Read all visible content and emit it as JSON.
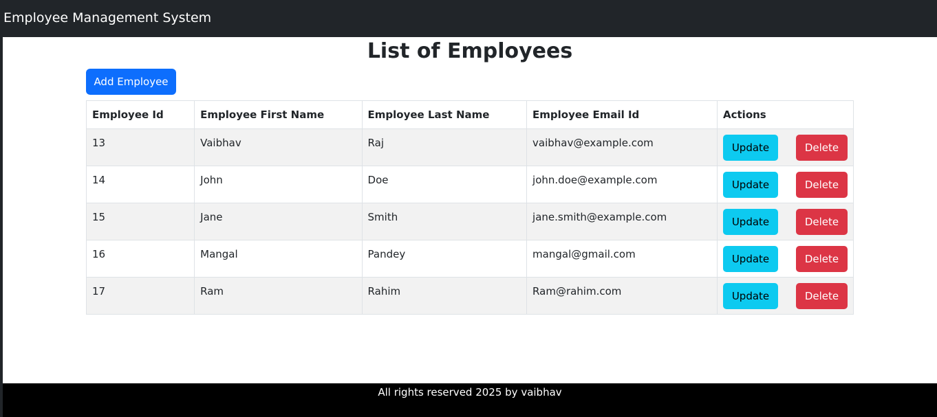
{
  "navbar": {
    "brand": "Employee Management System"
  },
  "main": {
    "title": "List of Employees",
    "add_button_label": "Add Employee"
  },
  "table": {
    "headers": [
      "Employee Id",
      "Employee First Name",
      "Employee Last Name",
      "Employee Email Id",
      "Actions"
    ],
    "rows": [
      {
        "id": "13",
        "first_name": "Vaibhav",
        "last_name": "Raj",
        "email": "vaibhav@example.com"
      },
      {
        "id": "14",
        "first_name": "John",
        "last_name": "Doe",
        "email": "john.doe@example.com"
      },
      {
        "id": "15",
        "first_name": "Jane",
        "last_name": "Smith",
        "email": "jane.smith@example.com"
      },
      {
        "id": "16",
        "first_name": "Mangal",
        "last_name": "Pandey",
        "email": "mangal@gmail.com"
      },
      {
        "id": "17",
        "first_name": "Ram",
        "last_name": "Rahim",
        "email": "Ram@rahim.com"
      }
    ],
    "update_label": "Update",
    "delete_label": "Delete"
  },
  "footer": {
    "text": "All rights reserved 2025 by vaibhav"
  },
  "colors": {
    "navbar_bg": "#212529",
    "primary": "#0d6efd",
    "info": "#0dcaf0",
    "danger": "#dc3545",
    "footer_bg": "#000000"
  }
}
